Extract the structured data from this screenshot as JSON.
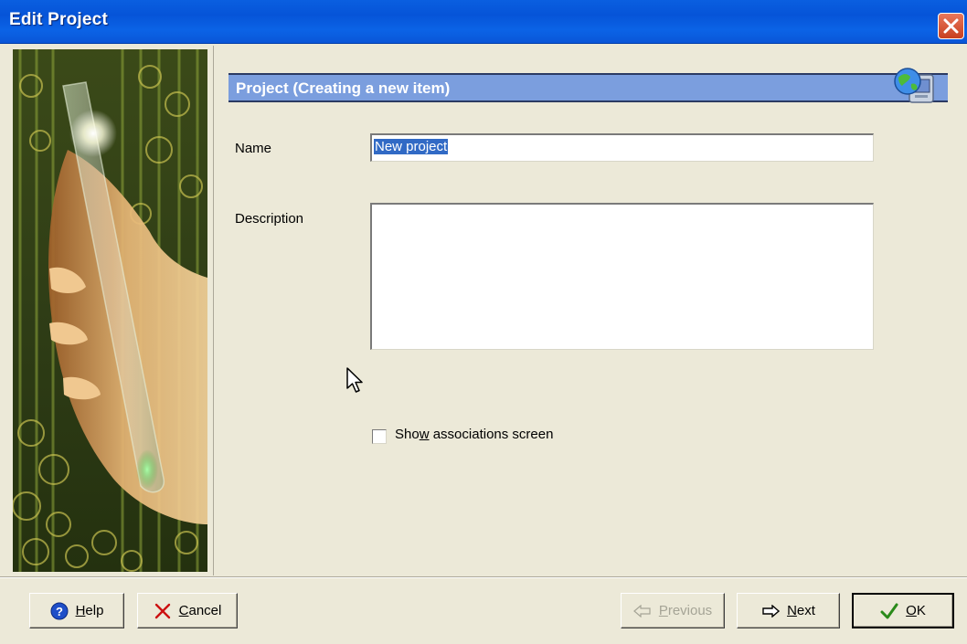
{
  "window": {
    "title": "Edit Project"
  },
  "header": {
    "title": "Project (Creating a new item)",
    "icon": "globe-computer-icon"
  },
  "form": {
    "name_label": "Name",
    "name_value": "New project",
    "description_label": "Description",
    "description_value": "",
    "checkbox_label_pre": "Sho",
    "checkbox_label_accel": "w",
    "checkbox_label_post": " associations screen",
    "checkbox_checked": false
  },
  "buttons": {
    "help": {
      "accel": "H",
      "rest": "elp"
    },
    "cancel": {
      "accel": "C",
      "rest": "ancel"
    },
    "previous": {
      "accel": "P",
      "rest": "revious",
      "enabled": false
    },
    "next": {
      "accel": "N",
      "rest": "ext"
    },
    "ok": {
      "accel": "O",
      "rest": "K"
    }
  },
  "colors": {
    "titlebar": "#0a5fe0",
    "header_bar": "#7b9ede",
    "dialog_bg": "#ece9d8",
    "ok_check": "#2a8a1a",
    "cancel_x": "#cc1010"
  }
}
